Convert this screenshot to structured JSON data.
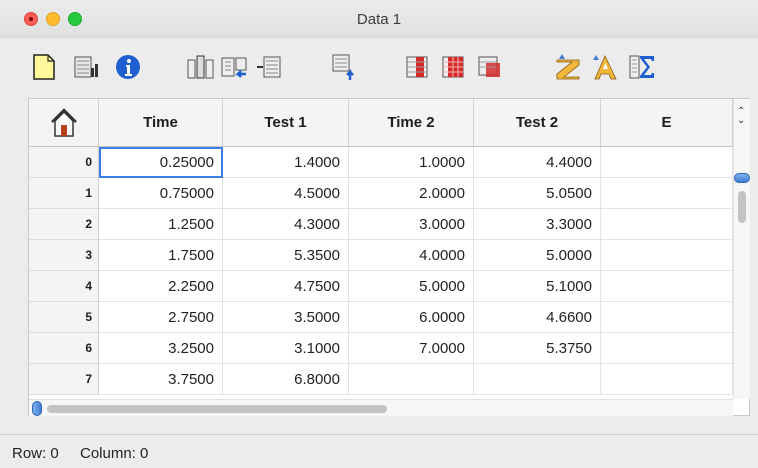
{
  "window": {
    "title": "Data 1"
  },
  "toolbar": {
    "buttons": [
      {
        "name": "new-data-button",
        "icon": "new-page-icon"
      },
      {
        "name": "new-graph-button",
        "icon": "graph-icon"
      },
      {
        "name": "info-button",
        "icon": "info-icon"
      },
      {
        "name": "insert-column-button",
        "icon": "insert-column-icon"
      },
      {
        "name": "insert-row-button",
        "icon": "insert-row-icon"
      },
      {
        "name": "delete-column-button",
        "icon": "delete-column-icon"
      },
      {
        "name": "delete-row-button",
        "icon": "delete-row-icon"
      },
      {
        "name": "fill-column-button",
        "icon": "fill-column-icon"
      },
      {
        "name": "fill-table-button",
        "icon": "fill-table-icon"
      },
      {
        "name": "clear-cells-button",
        "icon": "clear-cells-icon"
      },
      {
        "name": "sort-ascending-button",
        "icon": "sort-ascending-icon"
      },
      {
        "name": "sort-descending-button",
        "icon": "sort-descending-icon"
      },
      {
        "name": "statistics-button",
        "icon": "sigma-icon"
      }
    ]
  },
  "table": {
    "columns": [
      "Time",
      "Test 1",
      "Time 2",
      "Test 2",
      "E"
    ],
    "rows": [
      {
        "index": "0",
        "cells": [
          "0.25000",
          "1.4000",
          "1.0000",
          "4.4000",
          ""
        ]
      },
      {
        "index": "1",
        "cells": [
          "0.75000",
          "4.5000",
          "2.0000",
          "5.0500",
          ""
        ]
      },
      {
        "index": "2",
        "cells": [
          "1.2500",
          "4.3000",
          "3.0000",
          "3.3000",
          ""
        ]
      },
      {
        "index": "3",
        "cells": [
          "1.7500",
          "5.3500",
          "4.0000",
          "5.0000",
          ""
        ]
      },
      {
        "index": "4",
        "cells": [
          "2.2500",
          "4.7500",
          "5.0000",
          "5.1000",
          ""
        ]
      },
      {
        "index": "5",
        "cells": [
          "2.7500",
          "3.5000",
          "6.0000",
          "4.6600",
          ""
        ]
      },
      {
        "index": "6",
        "cells": [
          "3.2500",
          "3.1000",
          "7.0000",
          "5.3750",
          ""
        ]
      },
      {
        "index": "7",
        "cells": [
          "3.7500",
          "6.8000",
          "",
          "",
          ""
        ]
      }
    ]
  },
  "status": {
    "row": "Row: 0",
    "column": "Column: 0"
  }
}
